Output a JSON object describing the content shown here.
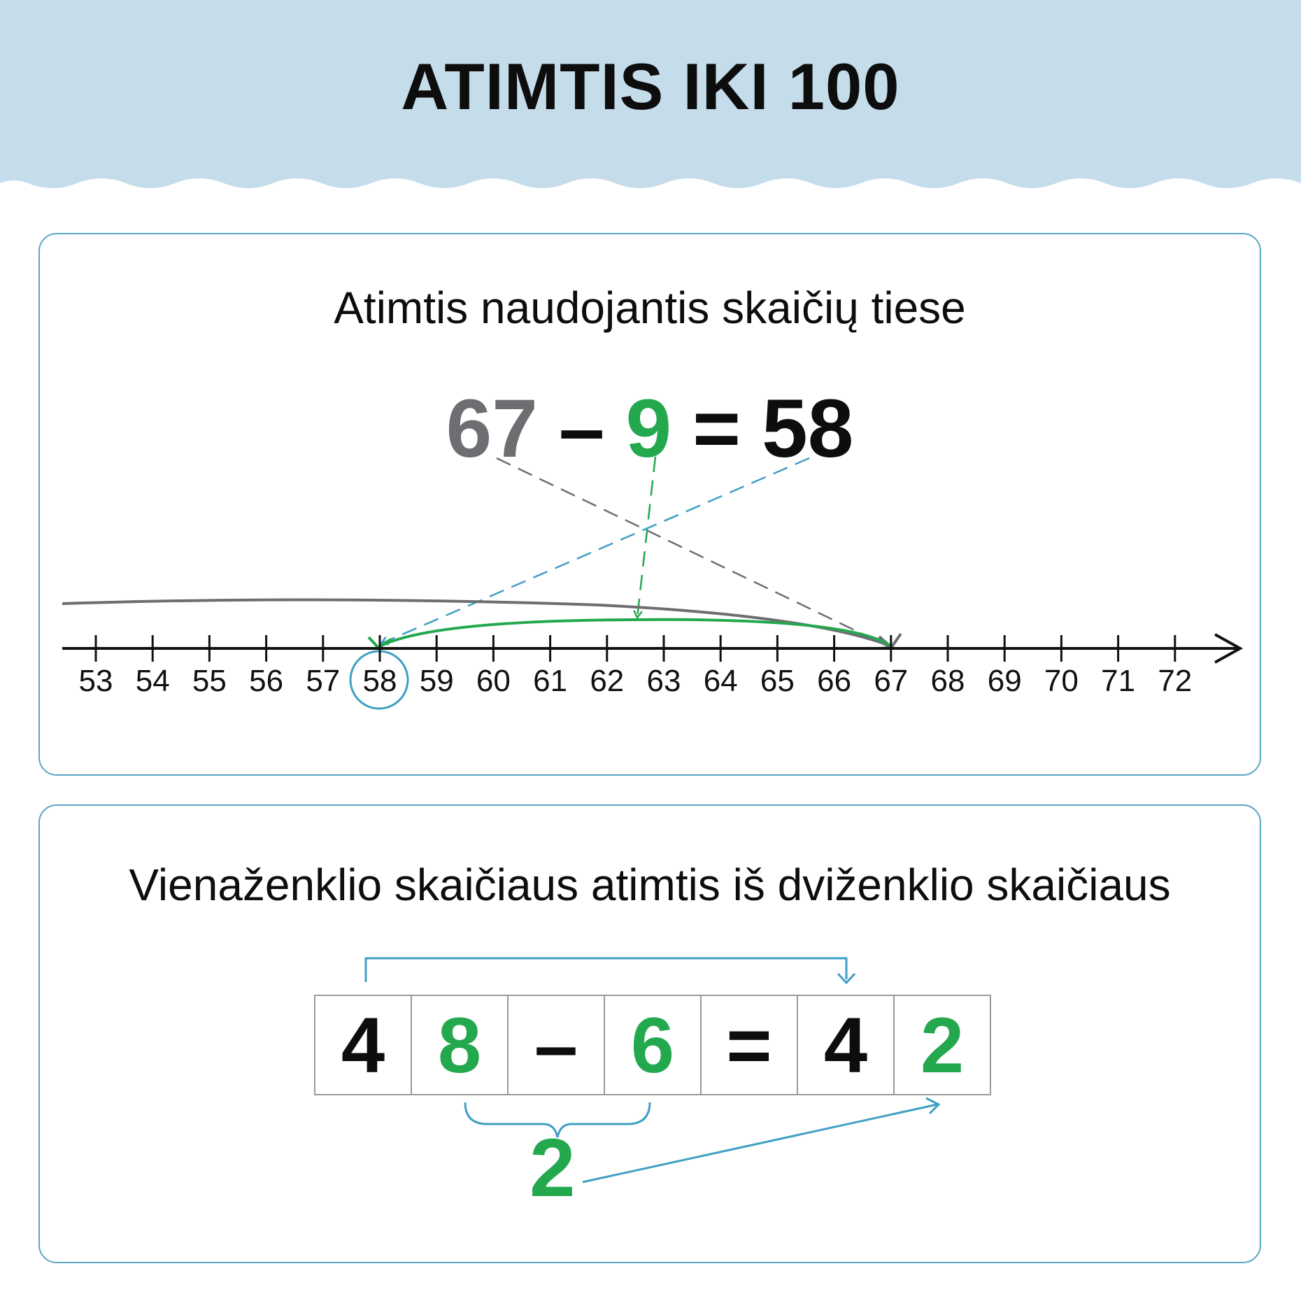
{
  "header": {
    "title": "ATIMTIS IKI 100",
    "bg_color": "#c5dceb"
  },
  "panel1": {
    "heading": "Atimtis naudojantis skaičių tiese",
    "equation": {
      "minuend": "67",
      "minus": "–",
      "subtrahend": "9",
      "equals": "=",
      "result": "58"
    },
    "number_line": {
      "ticks": [
        "53",
        "54",
        "55",
        "56",
        "57",
        "58",
        "59",
        "60",
        "61",
        "62",
        "63",
        "64",
        "65",
        "66",
        "67",
        "68",
        "69",
        "70",
        "71",
        "72"
      ],
      "start": 67,
      "jump": 9,
      "end": 58,
      "highlighted": "58"
    }
  },
  "panel2": {
    "heading": "Vienaženklio skaičiaus atimtis iš dviženklio skaičiaus",
    "cells": [
      {
        "text": "4",
        "color": "black"
      },
      {
        "text": "8",
        "color": "green"
      },
      {
        "text": "–",
        "color": "black"
      },
      {
        "text": "6",
        "color": "green"
      },
      {
        "text": "=",
        "color": "black"
      },
      {
        "text": "4",
        "color": "black"
      },
      {
        "text": "2",
        "color": "green"
      }
    ],
    "units_difference": "2"
  },
  "colors": {
    "grey": "#6d6e71",
    "green": "#23a84e",
    "blue": "#3f9fc4",
    "black": "#0d0d0d"
  }
}
